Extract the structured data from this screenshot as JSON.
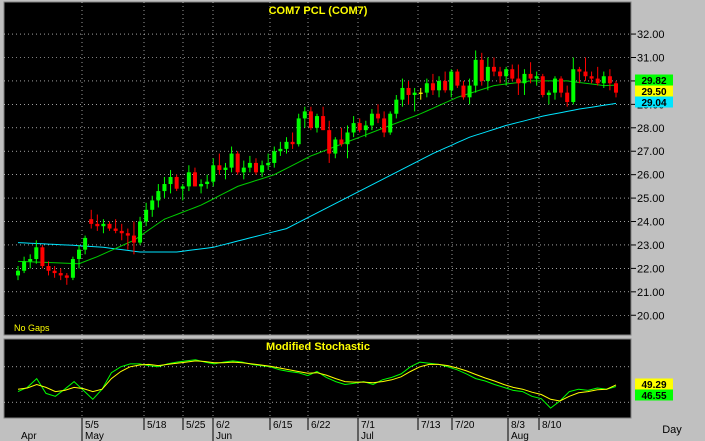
{
  "colors": {
    "background": "#000000",
    "frame": "#c0c0c0",
    "title": "#ffff00",
    "up_candle": "#00ff00",
    "down_candle": "#ff0000",
    "doji": "#ffff00",
    "ma_fast": "#00cc00",
    "ma_slow": "#00e5ff",
    "stoch_k": "#00ff00",
    "stoch_d": "#ffff00"
  },
  "chart_data": [
    {
      "type": "candlestick",
      "title": "COM7  PCL  (COM7)",
      "note": "No Gaps",
      "ylim": [
        19.2,
        32.6
      ],
      "y_ticks": [
        "32.00",
        "31.00",
        "30.00",
        "29.00",
        "28.00",
        "27.00",
        "26.00",
        "25.00",
        "24.00",
        "23.00",
        "22.00",
        "21.00",
        "20.00"
      ],
      "y_tick_values": [
        32,
        31,
        30,
        29,
        28,
        27,
        26,
        25,
        24,
        23,
        22,
        21,
        20
      ],
      "last_values": [
        {
          "value": "29.82",
          "color": "#00ff00"
        },
        {
          "value": "29.50",
          "color": "#ffff00"
        },
        {
          "value": "29.04",
          "color": "#00e5ff"
        }
      ],
      "candles": [
        [
          21.7,
          22.1,
          21.5,
          21.9
        ],
        [
          21.9,
          22.5,
          21.8,
          22.3
        ],
        [
          22.3,
          22.6,
          22.0,
          22.4
        ],
        [
          22.4,
          23.2,
          22.2,
          22.9
        ],
        [
          22.9,
          23.0,
          22.0,
          22.1
        ],
        [
          22.1,
          22.3,
          21.7,
          21.9
        ],
        [
          21.9,
          22.1,
          21.6,
          21.8
        ],
        [
          21.8,
          22.0,
          21.5,
          21.7
        ],
        [
          21.7,
          21.8,
          21.3,
          21.6
        ],
        [
          21.6,
          22.5,
          21.5,
          22.4
        ],
        [
          22.4,
          23.0,
          22.0,
          22.8
        ],
        [
          22.8,
          23.4,
          22.6,
          23.3
        ],
        [
          24.1,
          24.5,
          23.7,
          23.9
        ],
        [
          23.9,
          24.3,
          23.6,
          23.8
        ],
        [
          23.8,
          24.1,
          23.5,
          23.9
        ],
        [
          23.9,
          24.0,
          23.6,
          23.7
        ],
        [
          23.7,
          24.1,
          23.5,
          23.6
        ],
        [
          23.6,
          23.9,
          23.2,
          23.5
        ],
        [
          23.5,
          23.7,
          22.8,
          23.4
        ],
        [
          23.4,
          24.0,
          22.6,
          23.1
        ],
        [
          23.1,
          24.2,
          23.0,
          24.0
        ],
        [
          24.0,
          24.8,
          23.8,
          24.5
        ],
        [
          24.5,
          25.1,
          24.2,
          24.9
        ],
        [
          24.9,
          25.6,
          24.6,
          25.3
        ],
        [
          25.3,
          25.9,
          25.0,
          25.6
        ],
        [
          25.6,
          26.2,
          25.2,
          25.9
        ],
        [
          25.9,
          26.0,
          25.3,
          25.4
        ],
        [
          25.4,
          25.6,
          24.9,
          25.5
        ],
        [
          25.5,
          26.4,
          25.3,
          26.1
        ],
        [
          26.1,
          26.3,
          25.5,
          25.5
        ],
        [
          25.5,
          25.8,
          25.2,
          25.6
        ],
        [
          25.6,
          26.0,
          25.4,
          25.7
        ],
        [
          25.7,
          26.7,
          25.5,
          26.4
        ],
        [
          26.4,
          26.9,
          26.0,
          26.2
        ],
        [
          26.2,
          26.5,
          25.8,
          26.3
        ],
        [
          26.3,
          27.2,
          26.1,
          26.9
        ],
        [
          26.9,
          27.0,
          26.0,
          26.1
        ],
        [
          26.1,
          26.6,
          25.8,
          26.3
        ],
        [
          26.3,
          26.8,
          26.1,
          26.5
        ],
        [
          26.5,
          26.7,
          26.0,
          26.1
        ],
        [
          26.1,
          26.6,
          25.9,
          26.4
        ],
        [
          26.4,
          26.9,
          26.2,
          26.5
        ],
        [
          26.5,
          27.2,
          26.3,
          27.0
        ],
        [
          27.0,
          27.4,
          26.8,
          27.1
        ],
        [
          27.1,
          27.6,
          26.9,
          27.4
        ],
        [
          27.4,
          27.8,
          27.1,
          27.3
        ],
        [
          27.3,
          28.6,
          27.2,
          28.4
        ],
        [
          28.4,
          28.9,
          28.0,
          28.7
        ],
        [
          28.7,
          28.9,
          27.9,
          28.0
        ],
        [
          28.0,
          28.6,
          27.8,
          28.5
        ],
        [
          28.5,
          28.9,
          27.9,
          27.9
        ],
        [
          27.9,
          28.3,
          26.5,
          26.9
        ],
        [
          26.9,
          27.6,
          26.7,
          27.5
        ],
        [
          27.5,
          28.0,
          27.2,
          27.3
        ],
        [
          27.3,
          28.1,
          26.7,
          27.8
        ],
        [
          27.8,
          28.5,
          27.6,
          28.2
        ],
        [
          28.2,
          28.4,
          27.8,
          27.9
        ],
        [
          27.9,
          28.3,
          27.6,
          28.1
        ],
        [
          28.1,
          28.8,
          27.9,
          28.6
        ],
        [
          28.6,
          29.0,
          28.2,
          28.4
        ],
        [
          28.4,
          28.7,
          27.6,
          27.8
        ],
        [
          27.8,
          28.7,
          27.7,
          28.6
        ],
        [
          28.6,
          29.4,
          28.4,
          29.2
        ],
        [
          29.2,
          30.1,
          28.9,
          29.7
        ],
        [
          29.7,
          30.0,
          29.0,
          29.4
        ],
        [
          29.4,
          29.7,
          28.7,
          29.5
        ],
        [
          29.5,
          29.7,
          29.2,
          29.5
        ],
        [
          29.5,
          30.1,
          29.3,
          29.9
        ],
        [
          29.9,
          30.3,
          29.4,
          29.6
        ],
        [
          29.6,
          30.2,
          29.3,
          30.0
        ],
        [
          30.0,
          30.4,
          29.5,
          29.6
        ],
        [
          29.6,
          30.5,
          29.3,
          30.4
        ],
        [
          30.4,
          30.5,
          29.7,
          29.8
        ],
        [
          29.8,
          30.0,
          29.2,
          29.3
        ],
        [
          29.3,
          30.1,
          29.0,
          29.8
        ],
        [
          29.8,
          31.3,
          29.5,
          30.9
        ],
        [
          30.9,
          31.2,
          29.8,
          30.0
        ],
        [
          30.0,
          31.0,
          29.6,
          30.6
        ],
        [
          30.6,
          31.0,
          30.2,
          30.4
        ],
        [
          30.4,
          30.6,
          29.9,
          30.2
        ],
        [
          30.2,
          30.6,
          29.8,
          30.5
        ],
        [
          30.5,
          30.7,
          30.0,
          30.1
        ],
        [
          30.1,
          30.7,
          29.4,
          29.9
        ],
        [
          29.9,
          30.5,
          29.4,
          30.3
        ],
        [
          30.3,
          30.8,
          29.9,
          30.1
        ],
        [
          30.1,
          30.4,
          29.8,
          30.2
        ],
        [
          30.2,
          30.3,
          29.3,
          29.4
        ],
        [
          29.4,
          29.6,
          29.0,
          29.5
        ],
        [
          29.5,
          30.2,
          29.2,
          30.1
        ],
        [
          30.1,
          30.2,
          29.3,
          29.5
        ],
        [
          29.5,
          29.8,
          28.9,
          29.1
        ],
        [
          29.1,
          31.0,
          29.0,
          30.5
        ],
        [
          30.5,
          30.6,
          29.9,
          30.4
        ],
        [
          30.4,
          31.0,
          30.0,
          30.2
        ],
        [
          30.2,
          30.4,
          29.9,
          30.1
        ],
        [
          30.1,
          30.6,
          29.8,
          29.9
        ],
        [
          29.9,
          30.4,
          29.7,
          30.2
        ],
        [
          30.2,
          30.5,
          29.6,
          29.9
        ],
        [
          29.9,
          30.0,
          29.3,
          29.5
        ]
      ],
      "ma_fast_anchors": [
        [
          0,
          22.3
        ],
        [
          10,
          22.2
        ],
        [
          13,
          22.5
        ],
        [
          19,
          23.2
        ],
        [
          24,
          24.1
        ],
        [
          30,
          24.7
        ],
        [
          36,
          25.5
        ],
        [
          42,
          26.0
        ],
        [
          48,
          26.8
        ],
        [
          54,
          27.4
        ],
        [
          60,
          28.0
        ],
        [
          66,
          28.6
        ],
        [
          72,
          29.3
        ],
        [
          78,
          29.8
        ],
        [
          84,
          30.0
        ],
        [
          90,
          30.0
        ],
        [
          96,
          29.8
        ],
        [
          98,
          29.82
        ]
      ],
      "ma_slow_anchors": [
        [
          0,
          23.1
        ],
        [
          8,
          23.0
        ],
        [
          14,
          22.9
        ],
        [
          20,
          22.7
        ],
        [
          26,
          22.7
        ],
        [
          32,
          22.9
        ],
        [
          38,
          23.3
        ],
        [
          44,
          23.7
        ],
        [
          50,
          24.5
        ],
        [
          56,
          25.3
        ],
        [
          62,
          26.1
        ],
        [
          68,
          26.9
        ],
        [
          74,
          27.6
        ],
        [
          80,
          28.1
        ],
        [
          86,
          28.5
        ],
        [
          92,
          28.8
        ],
        [
          98,
          29.04
        ]
      ]
    },
    {
      "type": "line",
      "title": "Modified  Stochastic",
      "ylim": [
        0,
        100
      ],
      "last_values": [
        {
          "value": "49.29",
          "color": "#ffff00"
        },
        {
          "value": "46.55",
          "color": "#00ff00"
        }
      ],
      "series": [
        {
          "color": "#00ff00",
          "values": [
            38,
            45,
            60,
            35,
            30,
            42,
            55,
            40,
            25,
            42,
            70,
            80,
            85,
            85,
            82,
            80,
            85,
            88,
            90,
            92,
            88,
            85,
            88,
            90,
            88,
            84,
            82,
            80,
            75,
            72,
            70,
            65,
            72,
            62,
            55,
            50,
            52,
            55,
            50,
            58,
            62,
            68,
            80,
            88,
            86,
            84,
            80,
            75,
            68,
            60,
            56,
            50,
            45,
            40,
            38,
            30,
            26,
            10,
            22,
            38,
            42,
            40,
            44,
            42,
            46.55
          ]
        },
        {
          "color": "#ffff00",
          "values": [
            42,
            44,
            50,
            45,
            38,
            40,
            45,
            43,
            38,
            42,
            60,
            72,
            80,
            83,
            84,
            82,
            84,
            86,
            88,
            90,
            89,
            87,
            87,
            88,
            87,
            85,
            83,
            81,
            78,
            75,
            72,
            69,
            70,
            66,
            60,
            55,
            54,
            54,
            53,
            55,
            58,
            63,
            72,
            80,
            84,
            84,
            82,
            78,
            73,
            67,
            61,
            56,
            50,
            45,
            42,
            37,
            33,
            25,
            22,
            30,
            36,
            38,
            41,
            42,
            49.29
          ]
        }
      ]
    }
  ],
  "x_axis": {
    "labels_top": [
      "5/5",
      "5/18",
      "5/25",
      "6/2",
      "6/15",
      "6/22",
      "7/1",
      "7/13",
      "7/20",
      "8/3",
      "8/10"
    ],
    "labels_bottom": [
      "Apr",
      "May",
      "Jun",
      "Jul",
      "Aug"
    ],
    "period_label": "Day"
  }
}
